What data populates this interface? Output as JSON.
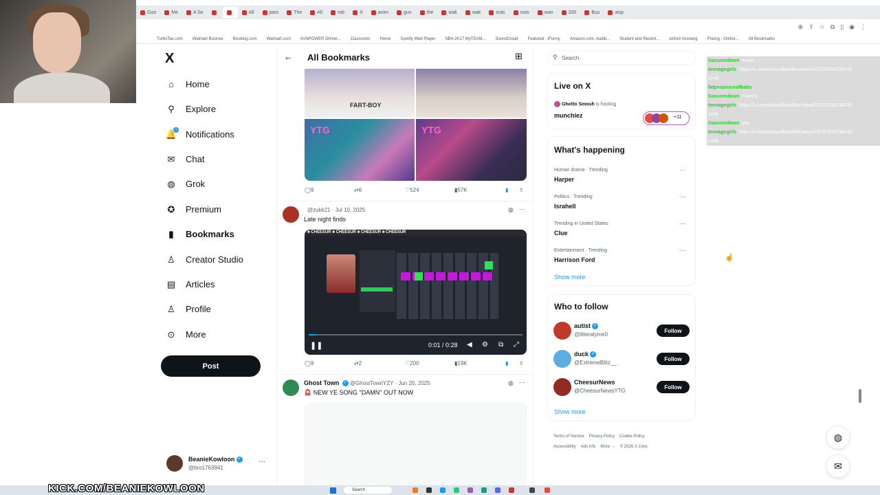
{
  "browser": {
    "tabs": [
      "Goo",
      "Me",
      "A Se",
      "",
      "",
      "All",
      "pars",
      "The",
      "All",
      "rob",
      "X",
      "anim",
      "gun",
      "the",
      "wak",
      "wak",
      "outs",
      "outs",
      "wan",
      "200",
      "Bus",
      "wcp"
    ],
    "bookmarks": [
      "TurboTax.com",
      "Walmart Busines",
      "Booking.com",
      "Walmart.com",
      "#UNPOWER Dhmer...",
      "Classroom",
      "Home",
      "Spotify Web Player",
      "NBA 2K17 MyTEAM...",
      "SoundCloud",
      "Featured - iFunny",
      "Amazon.com: Audib...",
      "Student and Recent...",
      "oxford mustang",
      "Pricing - Online...",
      "All Bookmarks"
    ]
  },
  "sidebar": {
    "logo": "X",
    "items": [
      {
        "label": "Home",
        "icon": "home-icon",
        "glyph": "⌂"
      },
      {
        "label": "Explore",
        "icon": "search-icon",
        "glyph": "⚲"
      },
      {
        "label": "Notifications",
        "icon": "bell-icon",
        "glyph": "🔔",
        "badge": "1"
      },
      {
        "label": "Chat",
        "icon": "mail-icon",
        "glyph": "✉"
      },
      {
        "label": "Grok",
        "icon": "grok-icon",
        "glyph": "◍"
      },
      {
        "label": "Premium",
        "icon": "premium-icon",
        "glyph": "✪"
      },
      {
        "label": "Bookmarks",
        "icon": "bookmark-icon",
        "glyph": "▮"
      },
      {
        "label": "Creator Studio",
        "icon": "creator-studio-icon",
        "glyph": "♙"
      },
      {
        "label": "Articles",
        "icon": "articles-icon",
        "glyph": "▤"
      },
      {
        "label": "Profile",
        "icon": "profile-icon",
        "glyph": "♙"
      },
      {
        "label": "More",
        "icon": "more-icon",
        "glyph": "⊙"
      }
    ],
    "post_label": "Post",
    "account": {
      "name": "BeanieKowloon",
      "handle": "@bro1763941"
    }
  },
  "main": {
    "title": "All Bookmarks",
    "tweet1": {
      "media_labels": [
        "FART-BOY",
        "YTG",
        "YTG"
      ],
      "replies": "9",
      "reposts": "6",
      "likes": "524",
      "views": "57K"
    },
    "tweet2": {
      "handle": "@zukk21 · Jul 10, 2025",
      "text": "Late night finds",
      "banner": "■ CHEESUR  ■ CHEESUR  ■ CHEESUR  ■ CHEESUR",
      "time": "0:01 / 0:28",
      "replies": "9",
      "reposts": "2",
      "likes": "200",
      "views": "19K"
    },
    "tweet3": {
      "name": "Ghost Town",
      "handle": "@GhostTownYZY · Jun 20, 2025",
      "text": "🚨 NEW YE SONG \"DAMN\" OUT NOW"
    }
  },
  "right": {
    "search_placeholder": "Search",
    "live": {
      "title": "Live on X",
      "host": "Ghetto Smosh",
      "host_suffix": "is hosting",
      "show": "munchiez",
      "count": "+11"
    },
    "happening": {
      "title": "What's happening",
      "trends": [
        {
          "meta": "Human drama · Trending",
          "name": "Harper"
        },
        {
          "meta": "Politics · Trending",
          "name": "Israhell"
        },
        {
          "meta": "Trending in United States",
          "name": "Clue"
        },
        {
          "meta": "Entertainment · Trending",
          "name": "Harrison Ford"
        }
      ],
      "show_more": "Show more"
    },
    "who_to_follow": {
      "title": "Who to follow",
      "users": [
        {
          "name": "autist",
          "handle": "@litteralyme0",
          "verified": true,
          "color": "#c0392b"
        },
        {
          "name": "duck",
          "handle": "@ExtremeBlitz__",
          "verified": true,
          "color": "#5dade2"
        },
        {
          "name": "CheesurNews",
          "handle": "@CheesurNewsYTG",
          "verified": false,
          "color": "#922b21"
        }
      ],
      "follow_label": "Follow",
      "show_more": "Show more"
    },
    "footer": [
      "Terms of Service",
      "Privacy Policy",
      "Cookie Policy",
      "Accessibility",
      "Ads info",
      "More ···",
      "© 2026 X Corp."
    ]
  },
  "chat": [
    {
      "user": "Gassemdown",
      "text": ": lmfao"
    },
    {
      "user": "teenagegirls",
      "text": ": https://x.com/spicyuflashfilm/status/19797050238248"
    },
    {
      "user": "",
      "text": "s=46"
    },
    {
      "user": "fatpeopeareallbabs",
      "text": ":"
    },
    {
      "user": "Gassemdown",
      "text": ": I love it"
    },
    {
      "user": "teenagegirls",
      "text": ": https://x.com/spicyuflashfilm/status/19797050238248"
    },
    {
      "user": "",
      "text": "s=46"
    },
    {
      "user": "Gassemdown",
      "text": ": yes"
    },
    {
      "user": "teenagegirls",
      "text": ": https://x.com/spicyuflashfilm/status/19797050238248"
    },
    {
      "user": "",
      "text": "s=46"
    }
  ],
  "stream": {
    "banner": "KICK.COM/BEANIEKOWLOON",
    "taskbar_search": "Search"
  }
}
